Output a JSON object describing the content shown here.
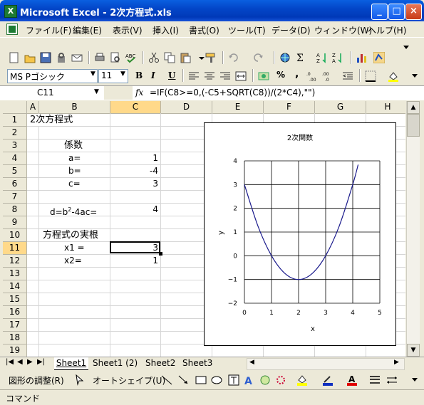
{
  "window": {
    "title": "Microsoft Excel - 2次方程式.xls",
    "app_icon": "X",
    "min": "_",
    "max": "□",
    "close": "×"
  },
  "menu": [
    "ファイル(F)",
    "編集(E)",
    "表示(V)",
    "挿入(I)",
    "書式(O)",
    "ツール(T)",
    "データ(D)",
    "ウィンドウ(W)",
    "ヘルプ(H)"
  ],
  "format": {
    "font": "MS Pゴシック",
    "size": "11",
    "bold": "B",
    "italic": "I",
    "underline": "U",
    "percent": "%",
    "comma": ","
  },
  "formula": {
    "name_box": "C11",
    "fx": "fx",
    "content": "=IF(C8>=0,(-C5+SQRT(C8))/(2*C4),\"\")"
  },
  "columns": [
    "A",
    "B",
    "C",
    "D",
    "E",
    "F",
    "G",
    "H"
  ],
  "rows": [
    "1",
    "2",
    "3",
    "4",
    "5",
    "6",
    "7",
    "8",
    "9",
    "10",
    "11",
    "12",
    "13",
    "14",
    "15",
    "16",
    "17",
    "18",
    "19"
  ],
  "cells": {
    "a1_title": "2次方程式",
    "b3": "係数",
    "b4": "a=",
    "c4": "1",
    "b5": "b=",
    "c5": "-4",
    "b6": "c=",
    "c6": "3",
    "b8_pre": "d=b",
    "b8_sup": "2",
    "b8_post": "-4ac=",
    "c8": "4",
    "b10": "方程式の実根",
    "b11": "x1 =",
    "c11": "3",
    "b12": "x2=",
    "c12": "1"
  },
  "sheets": [
    "Sheet1",
    "Sheet1 (2)",
    "Sheet2",
    "Sheet3"
  ],
  "drawing": {
    "adjust": "図形の調整(R)",
    "autoshape": "オートシェイプ(U)"
  },
  "status": "コマンド",
  "chart_data": {
    "type": "line",
    "title": "2次関数",
    "xlabel": "x",
    "ylabel": "y",
    "xlim": [
      0,
      5
    ],
    "ylim": [
      -2,
      4
    ],
    "xticks": [
      "0",
      "1",
      "2",
      "3",
      "4",
      "5"
    ],
    "yticks": [
      "4",
      "3",
      "2",
      "1",
      "0",
      "-1",
      "-2"
    ],
    "grid": true,
    "series": [
      {
        "color": "#1A1A8C",
        "x": [
          0,
          0.5,
          1,
          1.5,
          2,
          2.5,
          3,
          3.5,
          4,
          4.2
        ],
        "y": [
          3,
          1.25,
          0,
          -0.75,
          -1,
          -0.75,
          0,
          1.25,
          3,
          3.84
        ]
      }
    ]
  }
}
